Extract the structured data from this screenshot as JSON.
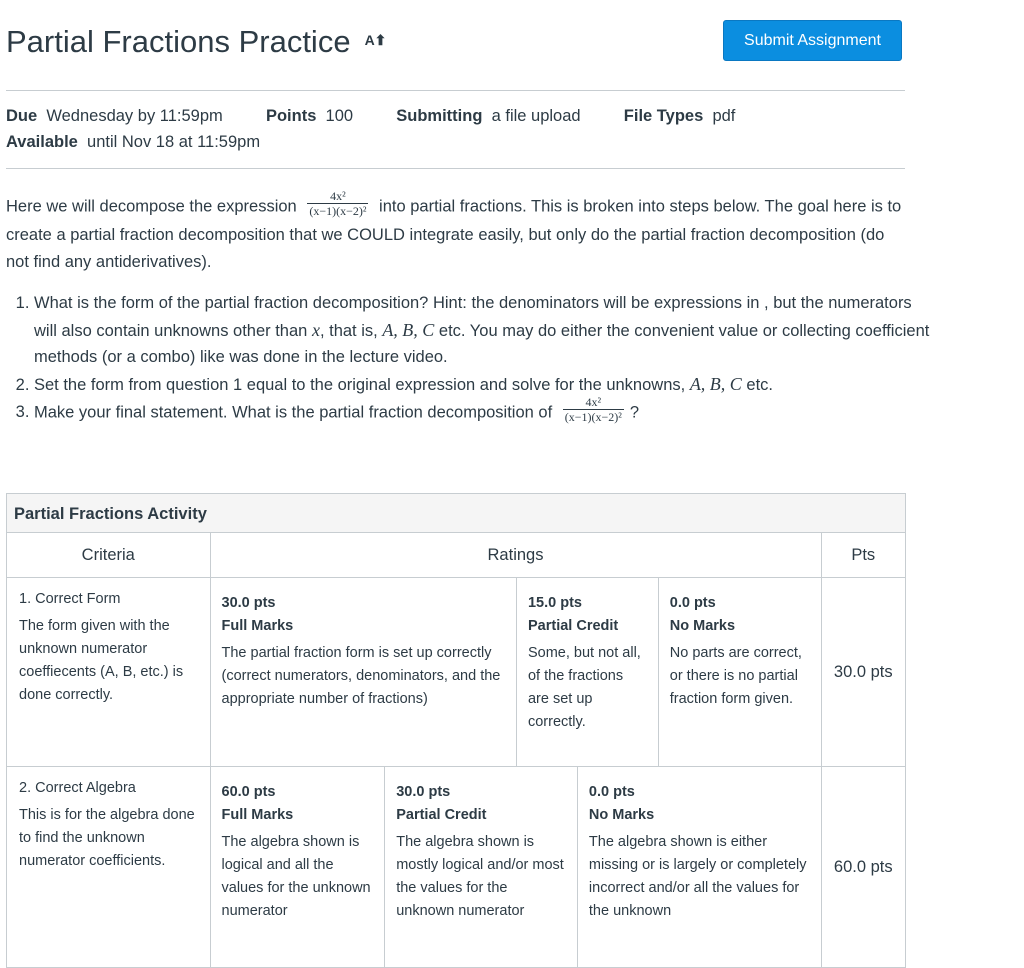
{
  "header": {
    "title": "Partial Fractions Practice",
    "title_icon": "A⬆",
    "submit_label": "Submit Assignment"
  },
  "details": {
    "due_label": "Due",
    "due_value": "Wednesday by 11:59pm",
    "points_label": "Points",
    "points_value": "100",
    "submitting_label": "Submitting",
    "submitting_value": "a file upload",
    "filetypes_label": "File Types",
    "filetypes_value": "pdf",
    "available_label": "Available",
    "available_value": "until Nov 18 at 11:59pm"
  },
  "description": {
    "intro_before": "Here we will decompose the expression",
    "frac_num": "4x²",
    "frac_den": "(x−1)(x−2)²",
    "intro_after": "into partial fractions. This is broken into steps below. The goal here is to create a partial fraction decomposition that we COULD integrate easily, but only do the partial fraction decomposition (do not find any antiderivatives).",
    "step1_a": "What is the form of the partial fraction decomposition? Hint: the denominators will be expressions in , but the numerators will also contain unknowns other than",
    "step1_x": "x",
    "step1_b": ", that is,",
    "step1_abc": "A, B, C",
    "step1_c": "etc. You may do either the convenient value or collecting coefficient methods (or a combo) like was done in the lecture video.",
    "step2_a": "Set the form from question 1 equal to the original expression and solve for the unknowns,",
    "step2_abc": "A, B, C",
    "step2_b": "etc.",
    "step3_a": "Make your final statement. What is the partial fraction decomposition of",
    "step3_b": "?"
  },
  "rubric": {
    "title": "Partial Fractions Activity",
    "col_criteria": "Criteria",
    "col_ratings": "Ratings",
    "col_pts": "Pts",
    "rows": [
      {
        "criterion_title": "1. Correct Form",
        "criterion_desc": "The form given with the unknown numerator coeffiecents (A, B, etc.) is done correctly.",
        "ratings": [
          {
            "points": "30.0 pts",
            "label": "Full Marks",
            "desc": "The partial fraction form is set up correctly (correct numerators, denominators, and the appropriate number of fractions)"
          },
          {
            "points": "15.0 pts",
            "label": "Partial Credit",
            "desc": "Some, but not all, of the fractions are set up correctly."
          },
          {
            "points": "0.0 pts",
            "label": "No Marks",
            "desc": "No parts are correct, or there is no partial fraction form given."
          }
        ],
        "pts": "30.0 pts"
      },
      {
        "criterion_title": "2. Correct Algebra",
        "criterion_desc": "This is for the algebra done to find the unknown numerator coefficients.",
        "ratings": [
          {
            "points": "60.0 pts",
            "label": "Full Marks",
            "desc": "The algebra shown is logical and all the values for the unknown numerator"
          },
          {
            "points": "30.0 pts",
            "label": "Partial Credit",
            "desc": "The algebra shown is mostly logical and/or most the values for the unknown numerator"
          },
          {
            "points": "0.0 pts",
            "label": "No Marks",
            "desc": "The algebra shown is either missing or is largely or completely incorrect and/or all the values for the unknown"
          }
        ],
        "pts": "60.0 pts"
      }
    ]
  }
}
